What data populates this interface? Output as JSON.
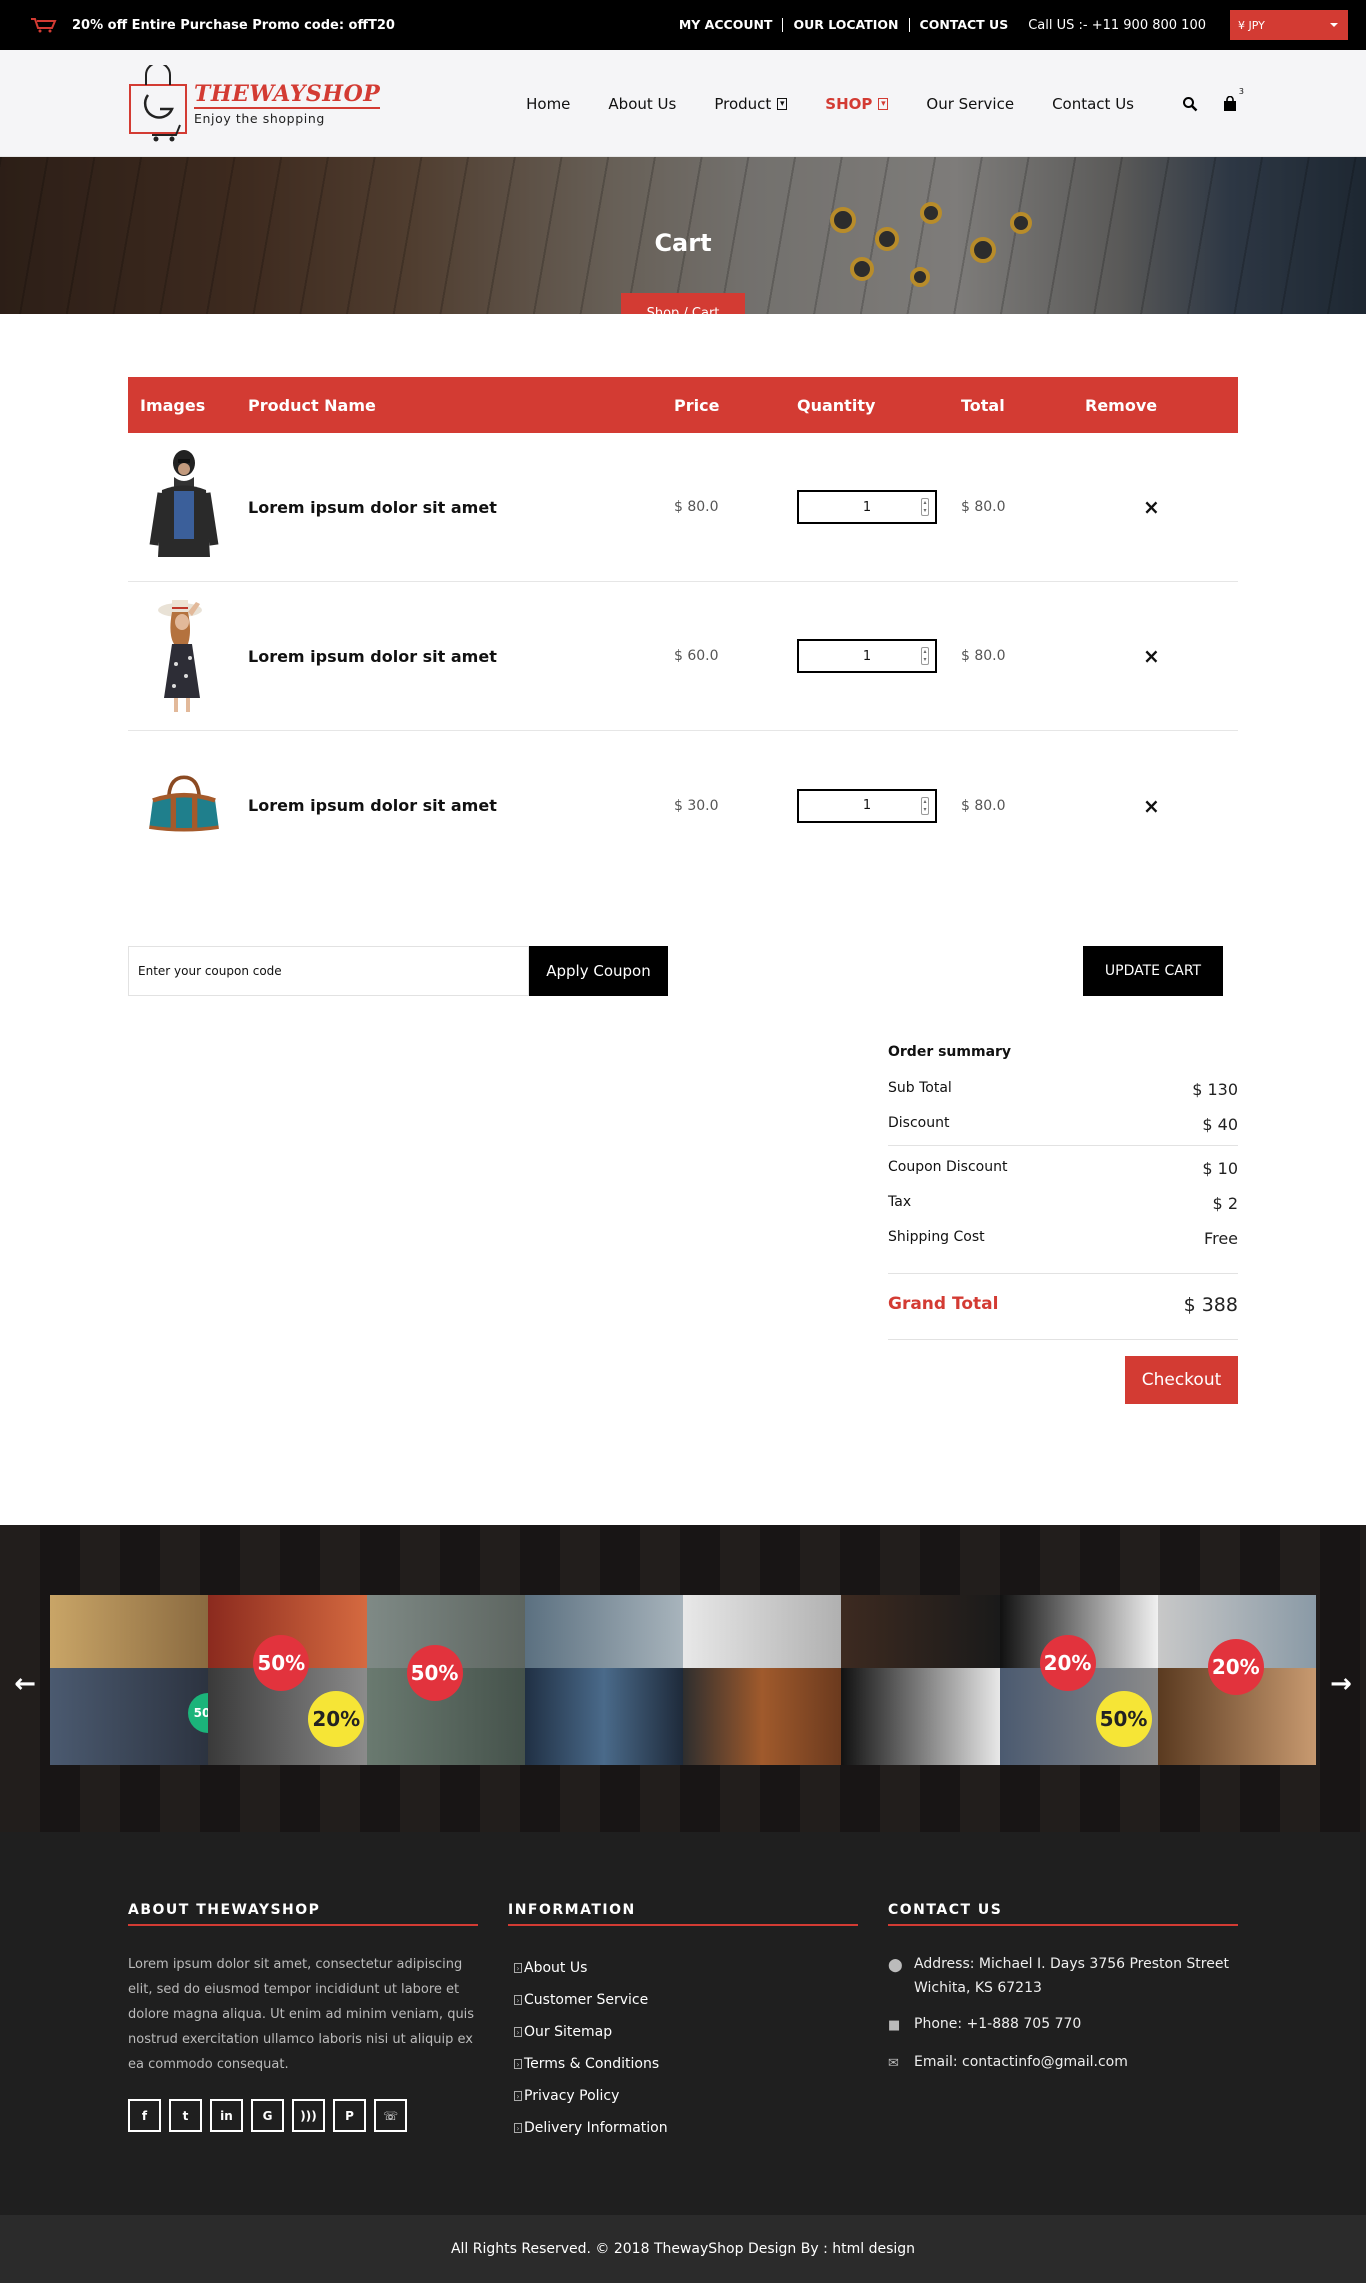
{
  "topbar": {
    "promo": "20% off Entire Purchase Promo code: offT20",
    "links": [
      "MY ACCOUNT",
      "OUR LOCATION",
      "CONTACT US"
    ],
    "call": "Call US :- +11 900 800 100",
    "currency": "¥ JPY"
  },
  "header": {
    "logo_name": "THEWAYSHOP",
    "logo_tagline": "Enjoy the shopping",
    "nav": [
      "Home",
      "About Us",
      "Product",
      "SHOP",
      "Our Service",
      "Contact Us"
    ],
    "cart_count": "3"
  },
  "banner": {
    "title": "Cart",
    "breadcrumb": "Shop / Cart"
  },
  "cart": {
    "headers": [
      "Images",
      "Product Name",
      "Price",
      "Quantity",
      "Total",
      "Remove"
    ],
    "rows": [
      {
        "name": "Lorem ipsum dolor sit amet",
        "price": "$ 80.0",
        "qty": "1",
        "total": "$ 80.0",
        "remove": "×"
      },
      {
        "name": "Lorem ipsum dolor sit amet",
        "price": "$ 60.0",
        "qty": "1",
        "total": "$ 80.0",
        "remove": "×"
      },
      {
        "name": "Lorem ipsum dolor sit amet",
        "price": "$ 30.0",
        "qty": "1",
        "total": "$ 80.0",
        "remove": "×"
      }
    ]
  },
  "coupon": {
    "placeholder": "Enter your coupon code",
    "apply_label": "Apply Coupon",
    "update_label": "UPDATE CART"
  },
  "summary": {
    "title": "Order summary",
    "sub_total_label": "Sub Total",
    "sub_total": "$ 130",
    "discount_label": "Discount",
    "discount": "$ 40",
    "coupon_discount_label": "Coupon Discount",
    "coupon_discount": "$ 10",
    "tax_label": "Tax",
    "tax": "$ 2",
    "shipping_label": "Shipping Cost",
    "shipping": "Free",
    "grand_total_label": "Grand Total",
    "grand_total": "$ 388",
    "checkout_label": "Checkout"
  },
  "gallery": {
    "badges": [
      "50%",
      "50%",
      "20%",
      "50%",
      "20%",
      "50%",
      "20%"
    ]
  },
  "footer": {
    "about_title": "ABOUT THEWAYSHOP",
    "about_text": "Lorem ipsum dolor sit amet, consectetur adipiscing elit, sed do eiusmod tempor incididunt ut labore et dolore magna aliqua. Ut enim ad minim veniam, quis nostrud exercitation ullamco laboris nisi ut aliquip ex ea commodo consequat.",
    "info_title": "INFORMATION",
    "info_links": [
      "About Us",
      "Customer Service",
      "Our Sitemap",
      "Terms & Conditions",
      "Privacy Policy",
      "Delivery Information"
    ],
    "contact_title": "CONTACT US",
    "address": "Address: Michael I. Days 3756 Preston Street Wichita, KS 67213",
    "phone": "Phone: +1-888 705 770",
    "email": "Email: contactinfo@gmail.com",
    "social": [
      "facebook-icon",
      "twitter-icon",
      "linkedin-icon",
      "google-plus-icon",
      "rss-icon",
      "pinterest-icon",
      "whatsapp-icon"
    ]
  },
  "copyright": "All Rights Reserved. © 2018 ThewayShop Design By : html design",
  "colors": {
    "accent": "#d33b33",
    "dark": "#000000",
    "footer": "#1f1f1f"
  }
}
